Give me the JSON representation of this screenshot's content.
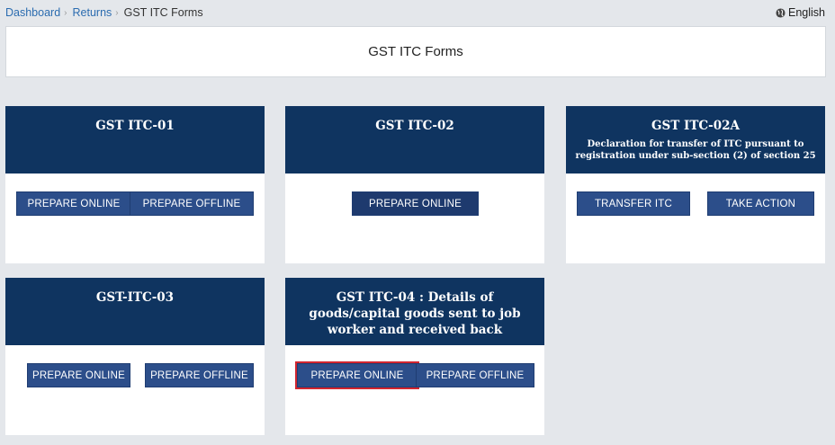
{
  "breadcrumb": {
    "dashboard": "Dashboard",
    "returns": "Returns",
    "current": "GST ITC Forms"
  },
  "language": {
    "label": "English"
  },
  "page": {
    "title": "GST ITC Forms"
  },
  "cards": {
    "itc01": {
      "title": "GST ITC-01",
      "buttons": [
        "PREPARE ONLINE",
        "PREPARE OFFLINE"
      ]
    },
    "itc02": {
      "title": "GST ITC-02",
      "buttons": [
        "PREPARE ONLINE"
      ]
    },
    "itc02a": {
      "title": "GST ITC-02A",
      "subtitle": "Declaration for transfer of ITC pursuant to registration under sub-section (2) of section 25",
      "buttons": [
        "TRANSFER ITC",
        "TAKE ACTION"
      ]
    },
    "itc03": {
      "title": "GST-ITC-03",
      "buttons": [
        "PREPARE ONLINE",
        "PREPARE OFFLINE"
      ]
    },
    "itc04": {
      "title": "GST ITC-04 : Details of goods/capital goods sent to job worker and received back",
      "buttons": [
        "PREPARE ONLINE",
        "PREPARE OFFLINE"
      ]
    }
  },
  "colors": {
    "header_bg": "#0f3460",
    "button_bg": "#2c4e8a",
    "highlight": "#d22630",
    "page_bg": "#e4e7eb"
  }
}
